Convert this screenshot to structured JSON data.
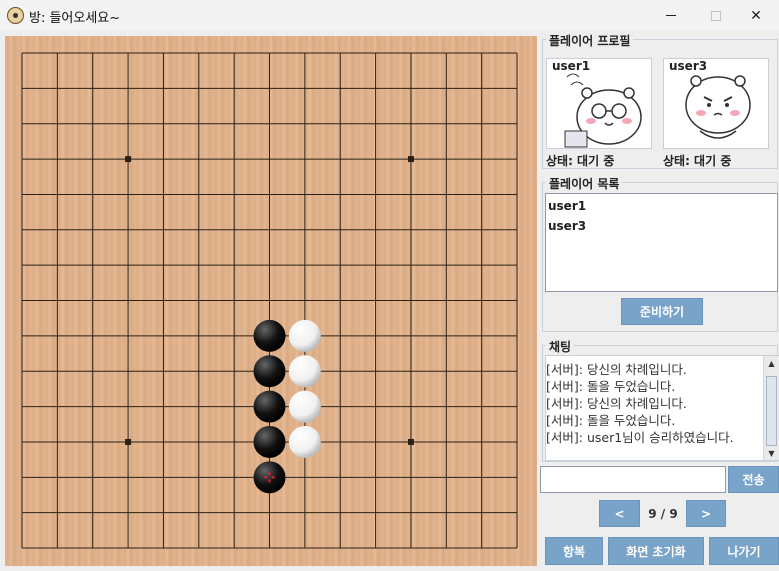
{
  "window": {
    "title": "방: 들어오세요~",
    "minimize_label": "—",
    "maximize_label": "☐",
    "close_label": "✕"
  },
  "board": {
    "size": 15,
    "black_stones": [
      [
        7,
        8
      ],
      [
        7,
        9
      ],
      [
        7,
        10
      ],
      [
        7,
        11
      ],
      [
        7,
        12
      ]
    ],
    "white_stones": [
      [
        8,
        8
      ],
      [
        8,
        9
      ],
      [
        8,
        10
      ],
      [
        8,
        11
      ]
    ],
    "star_points": [
      [
        3,
        3
      ],
      [
        11,
        3
      ],
      [
        3,
        11
      ],
      [
        11,
        11
      ]
    ],
    "last_move": [
      7,
      12
    ],
    "last_move_marker_color": "#e8232f"
  },
  "profile": {
    "section_title": "플레이어 프로필",
    "players": [
      {
        "name": "user1",
        "status": "상태: 대기 중",
        "avatar_icon": "hamster-glasses-icon"
      },
      {
        "name": "user3",
        "status": "상태: 대기 중",
        "avatar_icon": "hamster-angry-icon"
      }
    ]
  },
  "player_list": {
    "section_title": "플레이어 목록",
    "items": [
      "user1",
      "user3"
    ]
  },
  "ready_button": "준비하기",
  "chat": {
    "section_title": "채팅",
    "messages": [
      "[서버]: 당신의 차례입니다.",
      "[서버]: 돌을 두었습니다.",
      "[서버]: 당신의 차례입니다.",
      "[서버]: 돌을 두었습니다.",
      "[서버]: user1님이 승리하였습니다."
    ],
    "input_value": "",
    "send_button": "전송"
  },
  "paging": {
    "prev_label": "<",
    "next_label": ">",
    "page_text": "9 / 9"
  },
  "bottom_buttons": {
    "surrender": "항복",
    "reset_view": "화면 초기화",
    "exit": "나가기"
  },
  "colors": {
    "button_blue": "#7aa3c9",
    "board_wood": "#dfb18b"
  }
}
